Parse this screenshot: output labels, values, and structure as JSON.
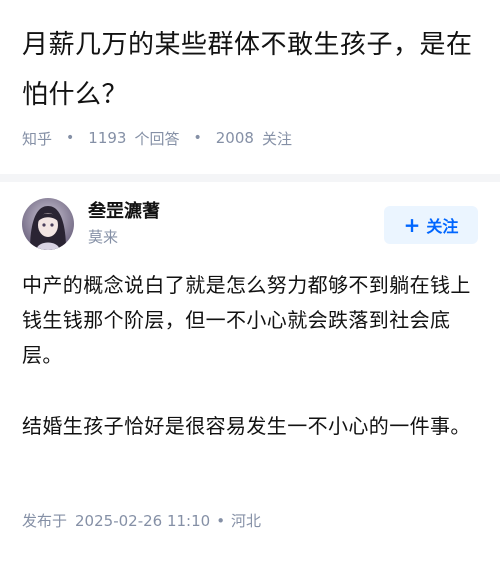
{
  "question": {
    "title": "月薪几万的某些群体不敢生孩子，是在怕什么？",
    "source": "知乎",
    "answers_count": "1193",
    "answers_label": "个回答",
    "followers_count": "2008",
    "followers_label": "关注"
  },
  "answer": {
    "author_name": "叁罡瀌蓍",
    "author_bio": "莫来",
    "follow_label": "关注",
    "paragraphs": [
      "中产的概念说白了就是怎么努力都够不到躺在钱上钱生钱那个阶层，但一不小心就会跌落到社会底层。",
      "结婚生孩子恰好是很容易发生一不小心的一件事。"
    ],
    "published_prefix": "发布于",
    "published_time": "2025-02-26  11:10",
    "location": "河北"
  },
  "colors": {
    "accent": "#0066ff",
    "muted": "#8590a6",
    "text": "#121212",
    "page_bg": "#f4f5f7"
  }
}
